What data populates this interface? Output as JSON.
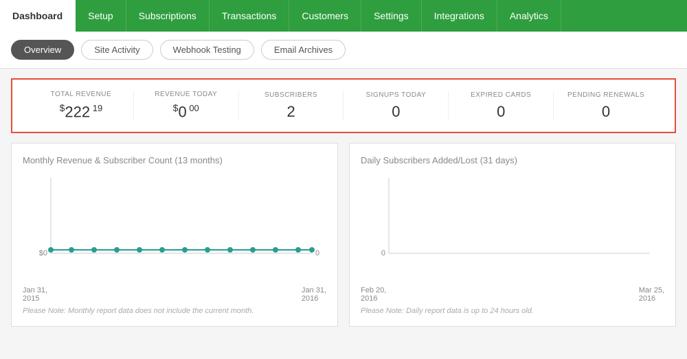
{
  "nav": {
    "items": [
      {
        "label": "Dashboard",
        "active": true
      },
      {
        "label": "Setup",
        "active": false
      },
      {
        "label": "Subscriptions",
        "active": false
      },
      {
        "label": "Transactions",
        "active": false
      },
      {
        "label": "Customers",
        "active": false
      },
      {
        "label": "Settings",
        "active": false
      },
      {
        "label": "Integrations",
        "active": false
      },
      {
        "label": "Analytics",
        "active": false
      }
    ]
  },
  "subnav": {
    "items": [
      {
        "label": "Overview",
        "active": true
      },
      {
        "label": "Site Activity",
        "active": false
      },
      {
        "label": "Webhook Testing",
        "active": false
      },
      {
        "label": "Email Archives",
        "active": false
      }
    ]
  },
  "stats": {
    "items": [
      {
        "label": "TOTAL REVENUE",
        "value": "222",
        "cents": "19",
        "prefix": "$"
      },
      {
        "label": "REVENUE TODAY",
        "value": "0",
        "cents": "00",
        "prefix": "$"
      },
      {
        "label": "SUBSCRIBERS",
        "value": "2",
        "cents": "",
        "prefix": ""
      },
      {
        "label": "SIGNUPS TODAY",
        "value": "0",
        "cents": "",
        "prefix": ""
      },
      {
        "label": "EXPIRED CARDS",
        "value": "0",
        "cents": "",
        "prefix": ""
      },
      {
        "label": "PENDING RENEWALS",
        "value": "0",
        "cents": "",
        "prefix": ""
      }
    ]
  },
  "charts": {
    "monthly": {
      "title": "Monthly Revenue & Subscriber Count",
      "subtitle": "(13 months)",
      "date_start": "Jan 31,\n2015",
      "date_end": "Jan 31,\n2016",
      "note": "Please Note: Monthly report data does not include the current month.",
      "y_label_left": "$0",
      "y_label_right": "0"
    },
    "daily": {
      "title": "Daily Subscribers Added/Lost",
      "subtitle": "(31 days)",
      "date_start": "Feb 20,\n2016",
      "date_end": "Mar 25,\n2016",
      "note": "Please Note: Daily report data is up to 24 hours old.",
      "y_label": "0"
    }
  }
}
